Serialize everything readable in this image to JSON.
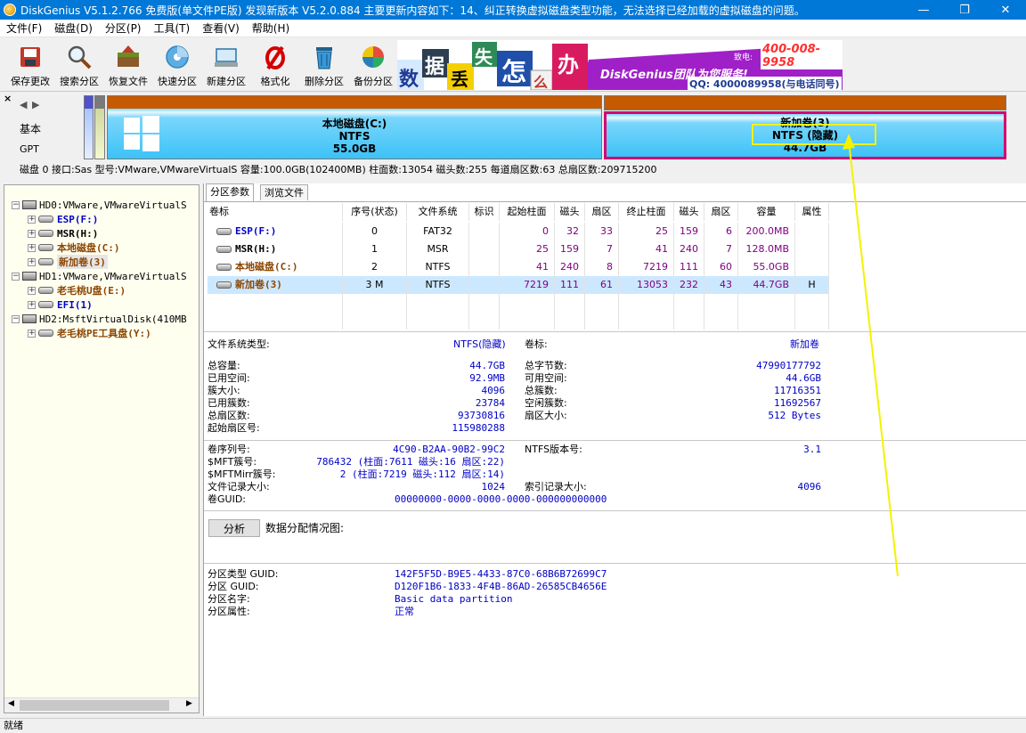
{
  "window": {
    "title": "DiskGenius V5.1.2.766 免费版(单文件PE版)    发现新版本 V5.2.0.884 主要更新内容如下：14、纠正转换虚拟磁盘类型功能，无法选择已经加载的虚拟磁盘的问题。",
    "minimize": "—",
    "restore": "❐",
    "close": "✕"
  },
  "menu": [
    "文件(F)",
    "磁盘(D)",
    "分区(P)",
    "工具(T)",
    "查看(V)",
    "帮助(H)"
  ],
  "toolbar": [
    {
      "label": "保存更改",
      "icon": "save-icon"
    },
    {
      "label": "搜索分区",
      "icon": "search-icon"
    },
    {
      "label": "恢复文件",
      "icon": "recover-icon"
    },
    {
      "label": "快速分区",
      "icon": "quick-partition-icon"
    },
    {
      "label": "新建分区",
      "icon": "new-partition-icon"
    },
    {
      "label": "格式化",
      "icon": "format-icon"
    },
    {
      "label": "删除分区",
      "icon": "delete-icon"
    },
    {
      "label": "备份分区",
      "icon": "backup-icon"
    }
  ],
  "banner": {
    "chars": [
      "数",
      "据",
      "丢",
      "失",
      "怎",
      "么",
      "办"
    ],
    "team": "DiskGenius团队为您服务!",
    "phone": "400-008-9958",
    "phone_prefix": "致电:",
    "qq": "QQ: 4000089958(与电话同号)"
  },
  "diskmap": {
    "left_labels": [
      "基本",
      "GPT"
    ],
    "partitions": [
      {
        "name": "本地磁盘(C:)",
        "fs": "NTFS",
        "size": "55.0GB"
      },
      {
        "name": "新加卷(3)",
        "fs": "NTFS (隐藏)",
        "size": "44.7GB"
      }
    ]
  },
  "diskinfo": "磁盘 0 接口:Sas  型号:VMware,VMwareVirtualS  容量:100.0GB(102400MB)  柱面数:13054  磁头数:255  每道扇区数:63  总扇区数:209715200",
  "tree": [
    {
      "label": "HD0:VMware,VMwareVirtualS",
      "type": "disk",
      "indent": 0,
      "color": "#000"
    },
    {
      "label": "ESP(F:)",
      "type": "part",
      "indent": 1,
      "color": "#0000c8"
    },
    {
      "label": "MSR(H:)",
      "type": "part",
      "indent": 1,
      "color": "#000"
    },
    {
      "label": "本地磁盘(C:)",
      "type": "part",
      "indent": 1,
      "color": "#8b4500"
    },
    {
      "label": "新加卷(3)",
      "type": "part",
      "indent": 1,
      "color": "#8b4500",
      "selected": true
    },
    {
      "label": "HD1:VMware,VMwareVirtualS",
      "type": "disk",
      "indent": 0,
      "color": "#000"
    },
    {
      "label": "老毛桃U盘(E:)",
      "type": "part",
      "indent": 1,
      "color": "#8b4500"
    },
    {
      "label": "EFI(1)",
      "type": "part",
      "indent": 1,
      "color": "#0000c8"
    },
    {
      "label": "HD2:MsftVirtualDisk(410MB",
      "type": "disk",
      "indent": 0,
      "color": "#000"
    },
    {
      "label": "老毛桃PE工具盘(Y:)",
      "type": "part",
      "indent": 1,
      "color": "#8b4500"
    }
  ],
  "tabs": [
    "分区参数",
    "浏览文件"
  ],
  "partition_table": {
    "headers": [
      "卷标",
      "序号(状态)",
      "文件系统",
      "标识",
      "起始柱面",
      "磁头",
      "扇区",
      "终止柱面",
      "磁头",
      "扇区",
      "容量",
      "属性"
    ],
    "rows": [
      {
        "name": "ESP(F:)",
        "color": "#0000c8",
        "cells": [
          "0",
          "FAT32",
          "",
          "0",
          "32",
          "33",
          "25",
          "159",
          "6",
          "200.0MB",
          ""
        ]
      },
      {
        "name": "MSR(H:)",
        "color": "#000",
        "cells": [
          "1",
          "MSR",
          "",
          "25",
          "159",
          "7",
          "41",
          "240",
          "7",
          "128.0MB",
          ""
        ]
      },
      {
        "name": "本地磁盘(C:)",
        "color": "#8b4500",
        "cells": [
          "2",
          "NTFS",
          "",
          "41",
          "240",
          "8",
          "7219",
          "111",
          "60",
          "55.0GB",
          ""
        ]
      },
      {
        "name": "新加卷(3)",
        "color": "#8b4500",
        "selected": true,
        "cells": [
          "3 M",
          "NTFS",
          "",
          "7219",
          "111",
          "61",
          "13053",
          "232",
          "43",
          "44.7GB",
          "H"
        ]
      }
    ]
  },
  "fsinfo": {
    "fs_type_label": "文件系统类型:",
    "fs_type_value": "NTFS(隐藏)",
    "vol_label": "卷标:",
    "vol_value": "新加卷",
    "left": [
      [
        "总容量:",
        "44.7GB"
      ],
      [
        "已用空间:",
        "92.9MB"
      ],
      [
        "簇大小:",
        "4096"
      ],
      [
        "已用簇数:",
        "23784"
      ],
      [
        "总扇区数:",
        "93730816"
      ],
      [
        "起始扇区号:",
        "115980288"
      ]
    ],
    "right": [
      [
        "总字节数:",
        "47990177792"
      ],
      [
        "可用空间:",
        "44.6GB"
      ],
      [
        "总簇数:",
        "11716351"
      ],
      [
        "空闲簇数:",
        "11692567"
      ],
      [
        "扇区大小:",
        "512 Bytes"
      ]
    ],
    "ntfs_left": [
      [
        "卷序列号:",
        "4C90-B2AA-90B2-99C2"
      ],
      [
        "$MFT簇号:",
        "786432 (柱面:7611 磁头:16 扇区:22)"
      ],
      [
        "$MFTMirr簇号:",
        "2 (柱面:7219 磁头:112 扇区:14)"
      ],
      [
        "文件记录大小:",
        "1024"
      ]
    ],
    "ntfs_right": [
      [
        "NTFS版本号:",
        "3.1"
      ],
      [
        "索引记录大小:",
        "4096"
      ]
    ],
    "guid_label": "卷GUID:",
    "guid_value": "00000000-0000-0000-0000-000000000000",
    "analyze_button": "分析",
    "alloc_label": "数据分配情况图:",
    "gpt": [
      [
        "分区类型 GUID:",
        "142F5F5D-B9E5-4433-87C0-68B6B72699C7"
      ],
      [
        "分区 GUID:",
        "D120F1B6-1833-4F4B-86AD-26585CB4656E"
      ],
      [
        "分区名字:",
        "Basic data partition"
      ],
      [
        "分区属性:",
        "正常"
      ]
    ]
  },
  "status": "就绪",
  "colors": {
    "accent": "#0078d7",
    "highlight": "#f5f200",
    "selected_partition_border": "#d6006e"
  }
}
